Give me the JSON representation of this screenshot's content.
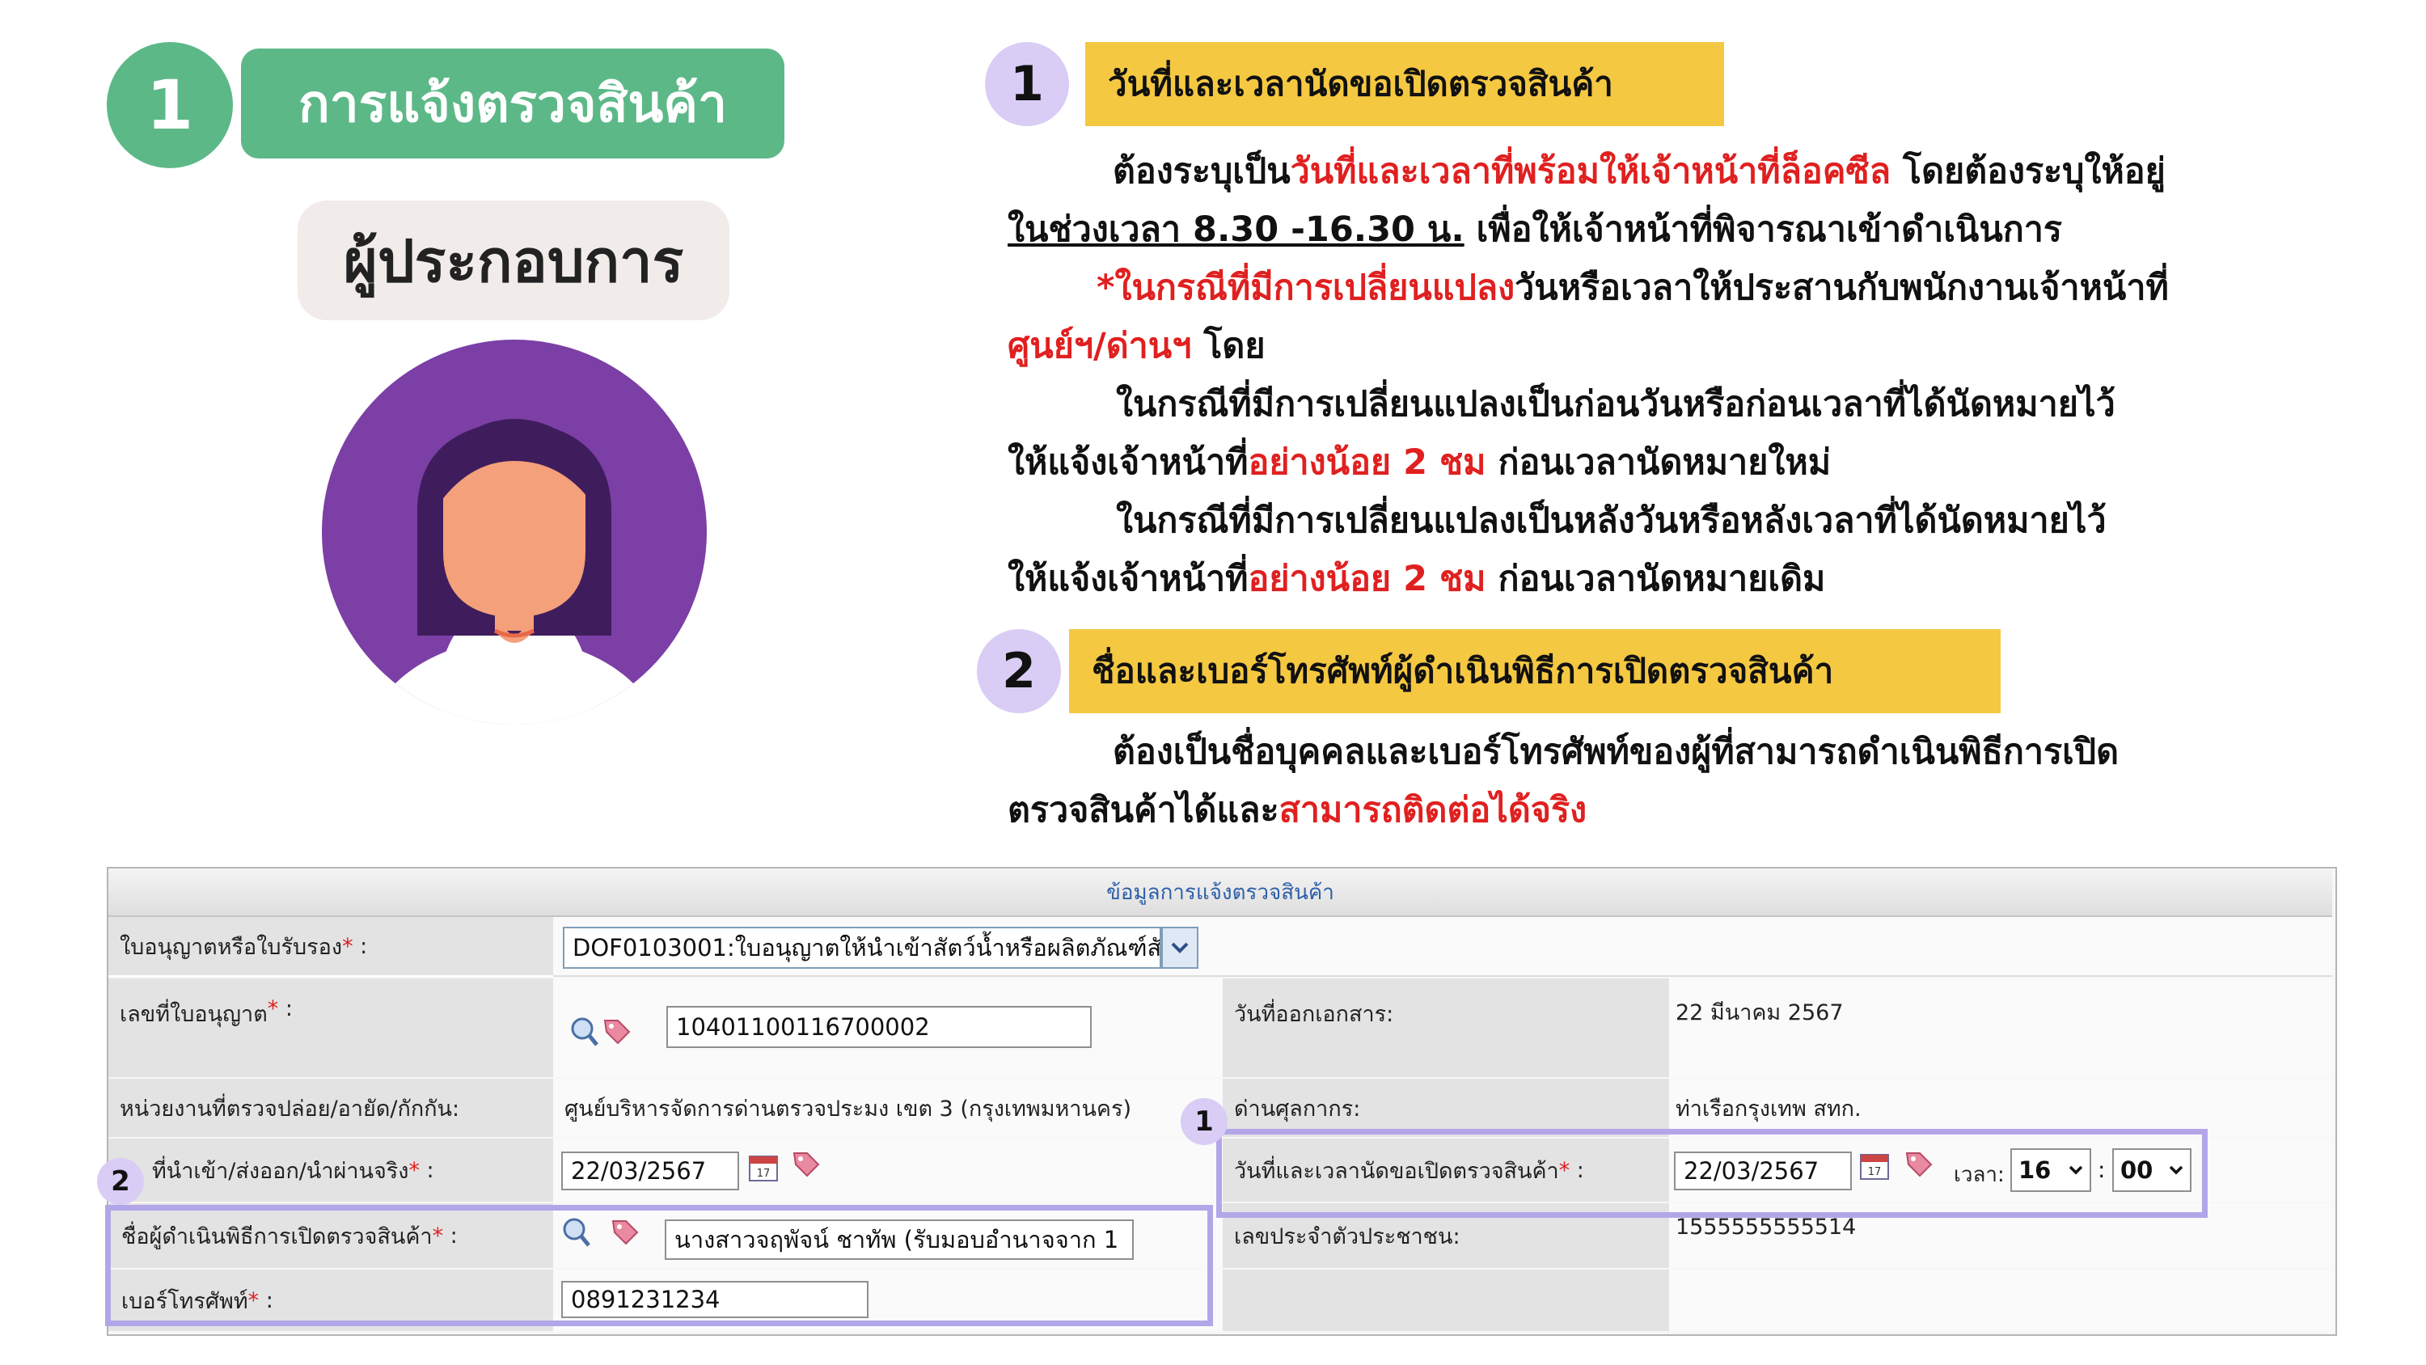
{
  "header": {
    "step_number": "1",
    "title": "การแจ้งตรวจสินค้า",
    "role": "ผู้ประกอบการ"
  },
  "colors": {
    "green": "#5db888",
    "yellow": "#f5c842",
    "lavender": "#d9ccf5",
    "highlight": "#b3a6e8",
    "red": "#e02020",
    "purple": "#7b3fa6"
  },
  "notes": {
    "sec1": {
      "num": "1",
      "title": "วันที่และเวลานัดขอเปิดตรวจสินค้า",
      "l1a": "ต้องระบุเป็น",
      "l1b": "วันที่และเวลาที่พร้อมให้เจ้าหน้าที่ล็อคซีล",
      "l1c": " โดยต้องระบุให้อยู่",
      "l2a": "ในช่วงเวลา 8.30 -16.30 น.",
      "l2b": " เพื่อให้เจ้าหน้าที่พิจารณาเข้าดำเนินการ",
      "l3a": "*ในกรณีที่มีการเปลี่ยนแปลง",
      "l3b": "วันหรือเวลาให้ประสานกับพนักงานเจ้าหน้าที่",
      "l4a": "ศูนย์ฯ/ด่านฯ",
      "l4b": " โดย",
      "l5": "ในกรณีที่มีการเปลี่ยนแปลงเป็นก่อนวันหรือก่อนเวลาที่ได้นัดหมายไว้",
      "l6a": "ให้แจ้งเจ้าหน้าที่",
      "l6b": "อย่างน้อย 2 ชม",
      "l6c": " ก่อนเวลานัดหมายใหม่",
      "l7": "ในกรณีที่มีการเปลี่ยนแปลงเป็นหลังวันหรือหลังเวลาที่ได้นัดหมายไว้",
      "l8a": "ให้แจ้งเจ้าหน้าที่",
      "l8b": "อย่างน้อย 2 ชม",
      "l8c": " ก่อนเวลานัดหมายเดิม"
    },
    "sec2": {
      "num": "2",
      "title": "ชื่อและเบอร์โทรศัพท์ผู้ดำเนินพิธีการเปิดตรวจสินค้า",
      "l1": "ต้องเป็นชื่อบุคคลและเบอร์โทรศัพท์ของผู้ที่สามารถดำเนินพิธีการเปิด",
      "l2a": "ตรวจสินค้าได้และ",
      "l2b": "สามารถติดต่อได้จริง"
    }
  },
  "form": {
    "title": "ข้อมูลการแจ้งตรวจสินค้า",
    "star": "*",
    "license_label": "ใบอนุญาตหรือใบรับรอง",
    "license_value": "DOF0103001:ใบอนุญาตให้นำเข้าสัตว์น้ำหรือผลิตภัณฑ์สั",
    "license_no_label": "เลขที่ใบอนุญาต",
    "license_no_value": "10401100116700002",
    "doc_date_label": "วันที่ออกเอกสาร:",
    "doc_date_value": "22 มีนาคม 2567",
    "agency_label": "หน่วยงานที่ตรวจปล่อย/อายัด/กักกัน:",
    "agency_value": "ศูนย์บริหารจัดการด่านตรวจประมง เขต 3 (กรุงเทพมหานคร)",
    "customs_label": "ด่านศุลกากร:",
    "customs_value": "ท่าเรือกรุงเทพ สทก.",
    "actual_date_label": "ที่นำเข้า/ส่งออก/นำผ่านจริง",
    "actual_date_value": "22/03/2567",
    "appt_label": "วันที่และเวลานัดขอเปิดตรวจสินค้า",
    "appt_date": "22/03/2567",
    "time_label": "เวลา:",
    "hour": "16",
    "minute": "00",
    "operator_label": "ชื่อผู้ดำเนินพิธีการเปิดตรวจสินค้า",
    "operator_value": "นางสาวจฤพัจน์ ชาทัพ (รับมอบอำนาจจาก 1",
    "id_label": "เลขประจำตัวประชาชน:",
    "id_value": "1555555555514",
    "phone_label": "เบอร์โทรศัพท์",
    "phone_value": "0891231234",
    "badge1": "1",
    "badge2": "2",
    "colon": ":"
  }
}
